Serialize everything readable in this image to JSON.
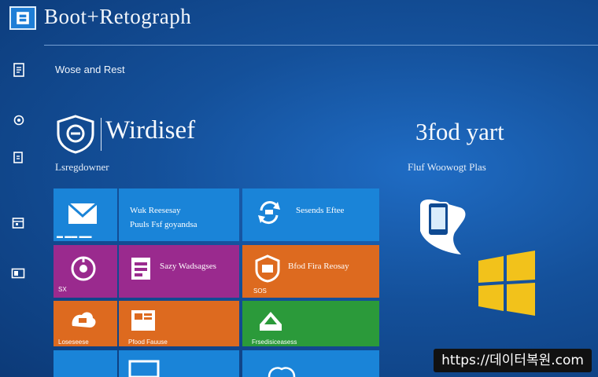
{
  "header": {
    "title": "Boot+Retograph",
    "logo_icon": "app-logo-icon"
  },
  "left_rail": {
    "icons": [
      "document-icon",
      "record-icon",
      "clipboard-icon",
      "calendar-icon",
      "window-icon"
    ]
  },
  "section_label": "Wose and Rest",
  "hero_left": {
    "title": "Wirdisef",
    "subtitle": "Lsregdowner",
    "icon": "shield-icon"
  },
  "hero_right": {
    "title": "3fod yart",
    "subtitle": "Fluf Woowogt Plas",
    "phone_icon": "phone-icon",
    "logo_icon": "windows-logo-icon"
  },
  "tiles": [
    {
      "name": "mail",
      "color": "#1a84d8",
      "icon": "mail-icon",
      "label": "",
      "small": ""
    },
    {
      "name": "recovery",
      "color": "#1a84d8",
      "icon": "",
      "label": "Wuk Reesesay",
      "label2": "Puuls Fsf goyandsa",
      "small": ""
    },
    {
      "name": "search",
      "color": "#1a84d8",
      "icon": "refresh-icon",
      "label": "Sesends Eftee",
      "small": ""
    },
    {
      "name": "support",
      "color": "#9a2a8e",
      "icon": "support-icon",
      "label": "",
      "small": "SX"
    },
    {
      "name": "registry",
      "color": "#9a2a8e",
      "icon": "registry-icon",
      "label": "Sazy Wadsagses",
      "small": ""
    },
    {
      "name": "restore",
      "color": "#dd6a1f",
      "icon": "restore-icon",
      "label": "Bfod Fira Reosay",
      "small": "SOS"
    },
    {
      "name": "tools",
      "color": "#dd6a1f",
      "icon": "tools-icon",
      "label": "",
      "small": "Loseseese"
    },
    {
      "name": "files",
      "color": "#dd6a1f",
      "icon": "files-icon",
      "label": "",
      "small": "Pfood Fauuse"
    },
    {
      "name": "photos",
      "color": "#2b9a3a",
      "icon": "photos-icon",
      "label": "",
      "small": "Frsedisiceasess"
    },
    {
      "name": "store",
      "color": "#1a84d8",
      "icon": "store-icon",
      "label": "",
      "small": ""
    },
    {
      "name": "cloud",
      "color": "#1a84d8",
      "icon": "cloud-icon",
      "label": "",
      "small": ""
    }
  ],
  "watermark": "https://데이터복원.com"
}
